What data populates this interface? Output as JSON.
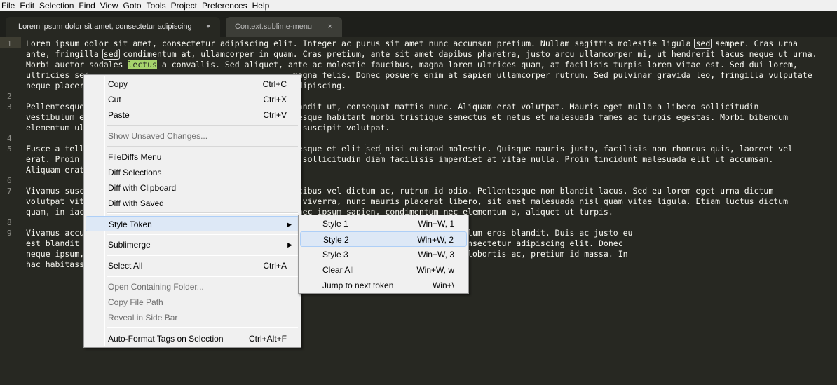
{
  "menubar": [
    "File",
    "Edit",
    "Selection",
    "Find",
    "View",
    "Goto",
    "Tools",
    "Project",
    "Preferences",
    "Help"
  ],
  "tabs": [
    {
      "label": "Lorem ipsum dolor sit amet, consectetur adipiscing",
      "close": "●"
    },
    {
      "label": "Context.sublime-menu",
      "close": "×"
    }
  ],
  "line_numbers": [
    "1",
    "2",
    "3",
    "4",
    "5",
    "6",
    "7",
    "8",
    "9"
  ],
  "editor_lines": [
    [
      "Lorem ipsum dolor sit amet, consectetur adipiscing elit. Integer ac purus sit amet nunc accumsan pretium. Nullam sagittis molestie ligula ",
      "sed",
      " semper. Cras urna"
    ],
    [
      "ante, fringilla ",
      "sed",
      " condimentum at, ullamcorper in quam. Cras pretium, ante sit amet dapibus pharetra, justo arcu ullamcorper mi, ut hendrerit lacus neque ut urna."
    ],
    [
      "Morbi auctor sodales ",
      "lectus",
      " a convallis. Sed aliquet, ante ac molestie faucibus, magna lorem ultrices quam, at facilisis turpis lorem vitae est. Sed dui lorem,"
    ],
    [
      "ultricies sed ",
      "",
      "                                         magna felis. Donec posuere enim at sapien ullamcorper rutrum. Sed pulvinar gravida leo, fringilla vulputate"
    ],
    [
      "neque placer",
      "",
      "                                       tum adipiscing."
    ],
    [
      "",
      ""
    ],
    [
      "Pellentesque",
      "",
      "                                       id blandit ut, consequat mattis nunc. Aliquam erat volutpat. Mauris eget nulla a libero sollicitudin"
    ],
    [
      "vestibulum e",
      "",
      "                                       llentesque habitant morbi tristique senectus et netus et malesuada fames ac turpis egestas. Morbi bibendum"
    ],
    [
      "elementum ul",
      "",
      "                                       ",
      "ectus",
      " suscipit volutpat."
    ],
    [
      "",
      ""
    ],
    [
      "Fusce a tell",
      "",
      "                                       llentesque et elit ",
      "sed",
      " nisi euismod molestie. Quisque mauris justo, facilisis non rhoncus quis, laoreet vel"
    ],
    [
      "erat. Proin ",
      "",
      "                                       justo sollicitudin diam facilisis imperdiet at vitae nulla. Proin tincidunt malesuada elit ut accumsan."
    ],
    [
      "Aliquam erat",
      ""
    ],
    [
      "",
      ""
    ],
    [
      "Vivamus susc",
      "",
      "                                       , faucibus vel dictum ac, rutrum id odio. Pellentesque non blandit lacus. Sed eu lorem eget urna dictum"
    ],
    [
      "volutpat vit",
      "",
      "                                       lisis viverra, nunc mauris placerat libero, sit amet malesuada nisl quam vitae ligula. Etiam luctus dictum"
    ],
    [
      "quam, in iac",
      "",
      "                                       a. Donec ipsum sapien, condimentum nec elementum a, aliquet ut turpis."
    ],
    [
      "",
      ""
    ],
    [
      "Vivamus accu",
      "",
      "                                       a eget magna scelerisque viverra vestibulum eros blandit. Duis ac justo eu"
    ],
    [
      "est blandit ",
      "",
      "                                       rper nec. Lorem ipsum dolor sit amet, consectetur adipiscing elit. Donec"
    ],
    [
      "neque ipsum,",
      "",
      "                                       or aliquet. Sed ante lacus, dictum quis lobortis ac, pretium id massa. In"
    ],
    [
      "hac habitass",
      ""
    ]
  ],
  "context_menu": [
    {
      "label": "Copy",
      "shortcut": "Ctrl+C",
      "disabled": false
    },
    {
      "label": "Cut",
      "shortcut": "Ctrl+X",
      "disabled": false
    },
    {
      "label": "Paste",
      "shortcut": "Ctrl+V",
      "disabled": false
    },
    {
      "label": "Show Unsaved Changes...",
      "shortcut": "",
      "disabled": true
    },
    {
      "label": "FileDiffs Menu",
      "shortcut": "",
      "disabled": false
    },
    {
      "label": "Diff Selections",
      "shortcut": "",
      "disabled": false
    },
    {
      "label": "Diff with Clipboard",
      "shortcut": "",
      "disabled": false
    },
    {
      "label": "Diff with Saved",
      "shortcut": "",
      "disabled": false
    },
    {
      "label": "Style Token",
      "shortcut": "",
      "disabled": false,
      "submenu": true
    },
    {
      "label": "Sublimerge",
      "shortcut": "",
      "disabled": false,
      "submenu": true
    },
    {
      "label": "Select All",
      "shortcut": "Ctrl+A",
      "disabled": false
    },
    {
      "label": "Open Containing Folder...",
      "shortcut": "",
      "disabled": true
    },
    {
      "label": "Copy File Path",
      "shortcut": "",
      "disabled": true
    },
    {
      "label": "Reveal in Side Bar",
      "shortcut": "",
      "disabled": true
    },
    {
      "label": "Auto-Format Tags on Selection",
      "shortcut": "Ctrl+Alt+F",
      "disabled": false
    }
  ],
  "submenu": [
    {
      "label": "Style 1",
      "shortcut": "Win+W, 1"
    },
    {
      "label": "Style 2",
      "shortcut": "Win+W, 2"
    },
    {
      "label": "Style 3",
      "shortcut": "Win+W, 3"
    },
    {
      "label": "Clear All",
      "shortcut": "Win+W, w"
    },
    {
      "label": "Jump to next token",
      "shortcut": "Win+\\"
    }
  ],
  "colors": {
    "editor_bg": "#272822",
    "text": "#f8f8f2",
    "highlight": "#a6d36c",
    "menu_bg": "#f0f0f0"
  }
}
